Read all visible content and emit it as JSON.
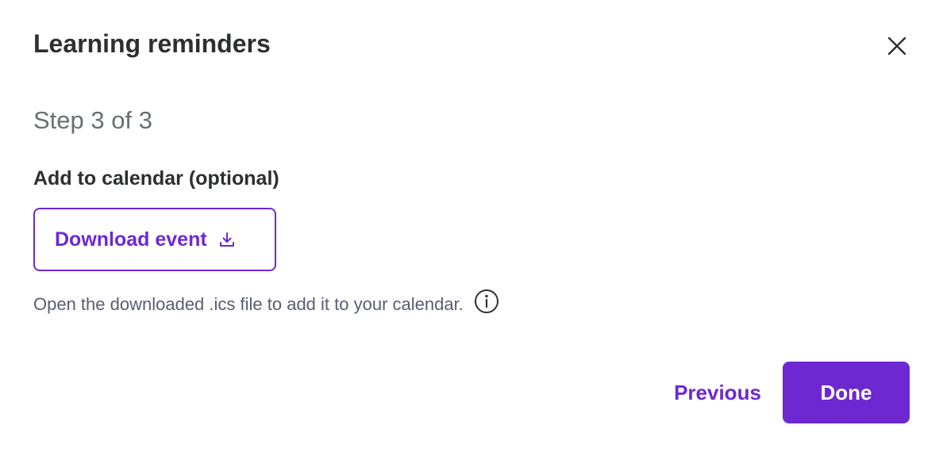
{
  "dialog": {
    "title": "Learning reminders",
    "close_icon": "close-icon"
  },
  "step": {
    "text": "Step 3 of 3"
  },
  "calendar": {
    "label": "Add to calendar (optional)",
    "download_label": "Download event",
    "download_icon": "download-icon",
    "hint": "Open the downloaded .ics file to add it to your calendar.",
    "info_icon": "info-icon"
  },
  "footer": {
    "previous_label": "Previous",
    "done_label": "Done"
  },
  "colors": {
    "accent": "#6d28d2",
    "text_primary": "#2d2f31",
    "text_secondary": "#6a6f73"
  }
}
